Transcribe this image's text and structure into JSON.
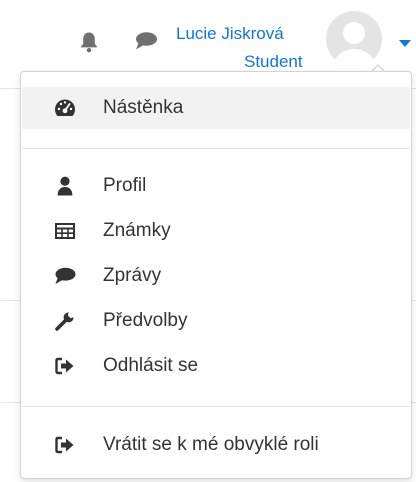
{
  "header": {
    "user_name": "Lucie Jiskrová",
    "user_role": "Student",
    "icons": {
      "notifications": "bell-icon",
      "messages": "speech-bubble-icon",
      "menu_toggle": "caret-down-icon"
    }
  },
  "menu": {
    "items": [
      {
        "label": "Nástěnka",
        "icon": "dashboard-gauge-icon"
      },
      {
        "label": "Profil",
        "icon": "user-icon"
      },
      {
        "label": "Známky",
        "icon": "table-icon"
      },
      {
        "label": "Zprávy",
        "icon": "speech-bubble-icon"
      },
      {
        "label": "Předvolby",
        "icon": "wrench-icon"
      },
      {
        "label": "Odhlásit se",
        "icon": "sign-out-icon"
      },
      {
        "label": "Vrátit se k mé obvyklé roli",
        "icon": "sign-out-icon"
      }
    ]
  },
  "colors": {
    "link": "#1177d1",
    "text": "#333333",
    "icon": "#333333",
    "header_icon": "#707070"
  }
}
